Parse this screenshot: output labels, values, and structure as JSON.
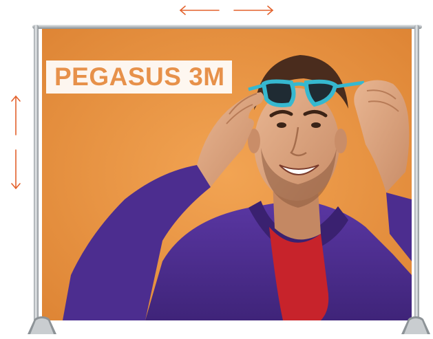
{
  "banner": {
    "title": "PEGASUS 3M"
  },
  "icons": {
    "horizontal_arrows": "double-horizontal-arrow-icon",
    "vertical_arrows": "double-vertical-arrow-icon"
  },
  "colors": {
    "arrow": "#e3612b",
    "banner_background": "#e89545",
    "title_text": "#e7914a",
    "hoodie": "#4b2c8c",
    "tshirt": "#c7232b",
    "glasses": "#36b8cf",
    "frame": "#b7bcc0"
  }
}
